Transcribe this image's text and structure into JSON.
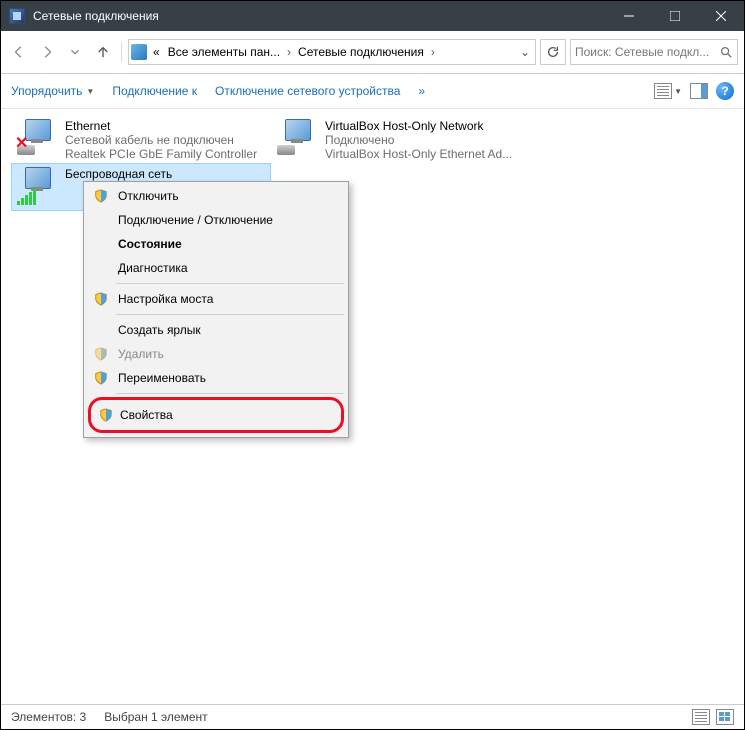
{
  "window": {
    "title": "Сетевые подключения"
  },
  "address": {
    "back_prefix": "«",
    "crumb1": "Все элементы пан...",
    "crumb2": "Сетевые подключения"
  },
  "search": {
    "placeholder": "Поиск: Сетевые подкл..."
  },
  "toolbar": {
    "organize": "Упорядочить",
    "connect": "Подключение к",
    "disable": "Отключение сетевого устройства",
    "more": "»"
  },
  "adapters": {
    "ethernet": {
      "name": "Ethernet",
      "status": "Сетевой кабель не подключен",
      "device": "Realtek PCIe GbE Family Controller"
    },
    "vbox": {
      "name": "VirtualBox Host-Only Network",
      "status": "Подключено",
      "device": "VirtualBox Host-Only Ethernet Ad..."
    },
    "wifi": {
      "name": "Беспроводная сеть"
    }
  },
  "context_menu": {
    "disconnect": "Отключить",
    "connect_disconnect": "Подключение / Отключение",
    "status": "Состояние",
    "diagnostics": "Диагностика",
    "bridge": "Настройка моста",
    "shortcut": "Создать ярлык",
    "delete": "Удалить",
    "rename": "Переименовать",
    "properties": "Свойства"
  },
  "statusbar": {
    "count": "Элементов: 3",
    "selected": "Выбран 1 элемент"
  }
}
